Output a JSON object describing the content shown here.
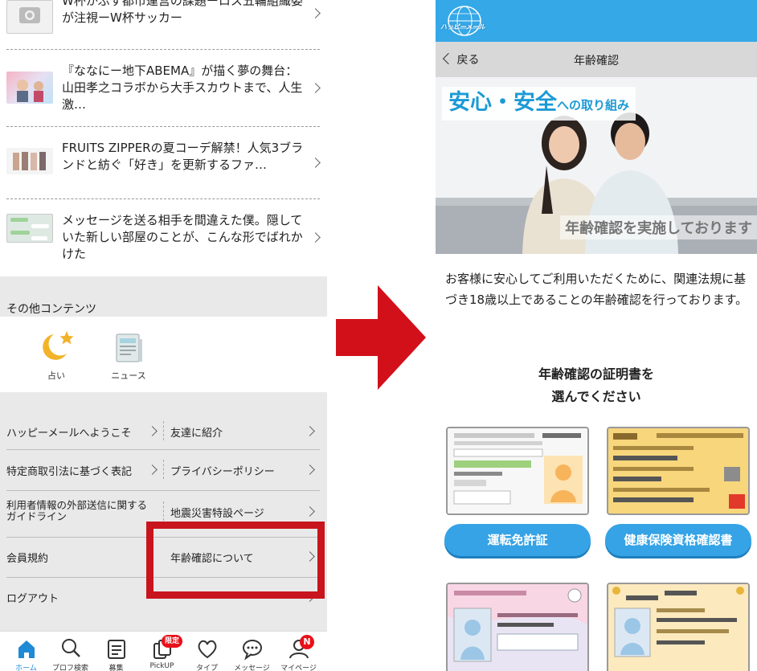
{
  "left": {
    "news": [
      {
        "title": "W杯かぶす都市運営の課題ーロス五輪組織委が注視ーW杯サッカー"
      },
      {
        "title": "『ななにー地下ABEMA』が描く夢の舞台：山田孝之コラボから大手スカウトまで、人生激…"
      },
      {
        "title": "FRUITS ZIPPERの夏コーデ解禁！人気3ブランドと紡ぐ「好き」を更新するファ…"
      },
      {
        "title": "メッセージを送る相手を間違えた僕。隠していた新しい部屋のことが、こんな形でばれかけた"
      }
    ],
    "other_contents": {
      "title": "その他コンテンツ",
      "items": [
        {
          "label": "占い",
          "icon": "moon-star-icon"
        },
        {
          "label": "ニュース",
          "icon": "newspaper-icon"
        }
      ]
    },
    "menu": [
      {
        "label": "ハッピーメールへようこそ"
      },
      {
        "label": "友達に紹介"
      },
      {
        "label": "特定商取引法に基づく表記"
      },
      {
        "label": "プライバシーポリシー"
      },
      {
        "label": "利用者情報の外部送信に関するガイドライン"
      },
      {
        "label": "地震災害特設ページ"
      },
      {
        "label": "会員規約"
      },
      {
        "label": "年齢確認について"
      },
      {
        "label": "ログアウト"
      }
    ],
    "tabs": [
      {
        "label": "ホーム",
        "icon": "home-icon",
        "active": true
      },
      {
        "label": "プロフ検索",
        "icon": "search-icon"
      },
      {
        "label": "募集",
        "icon": "board-icon"
      },
      {
        "label": "PickUP",
        "icon": "pickup-icon",
        "badge": "限定"
      },
      {
        "label": "タイプ",
        "icon": "heart-icon"
      },
      {
        "label": "メッセージ",
        "icon": "message-icon"
      },
      {
        "label": "マイページ",
        "icon": "person-icon",
        "badge": "N"
      }
    ],
    "highlight_color": "#c8141c"
  },
  "right": {
    "logo_text": "ハッピーメール",
    "back_label": "戻る",
    "page_title": "年齢確認",
    "banner": {
      "headline_main": "安心・安全",
      "headline_sub": "への取り組み",
      "caption": "年齢確認を実施しております"
    },
    "intro": "お客様に安心してご利用いただくために、関連法規に基づき18歳以上であることの年齢確認を行っております。",
    "doc_title_line1": "年齢確認の証明書を",
    "doc_title_line2": "選んでください",
    "documents": [
      {
        "label": "運転免許証"
      },
      {
        "label": "健康保険資格確認書"
      }
    ],
    "accent_color": "#35a8e8"
  }
}
